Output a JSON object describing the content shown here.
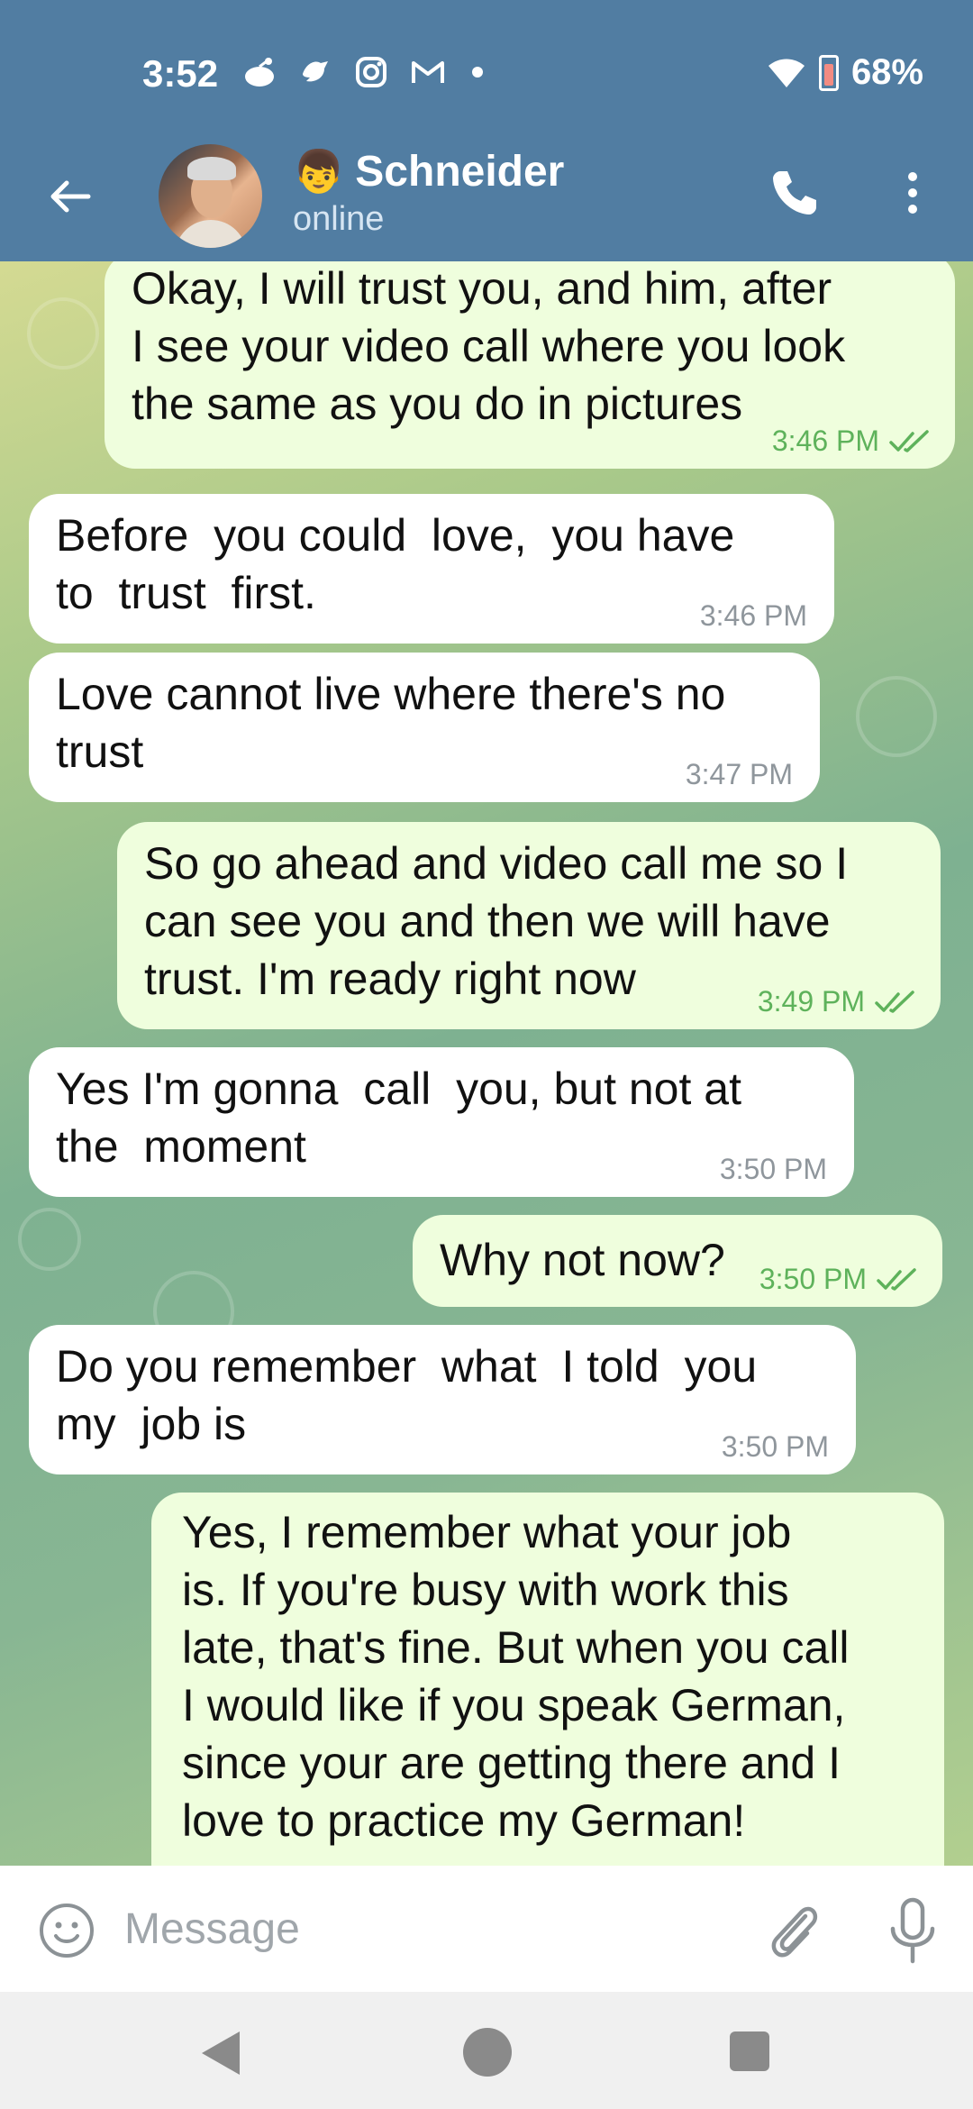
{
  "status_bar": {
    "time": "3:52",
    "battery": "68%",
    "notification_icons": [
      "reddit-icon",
      "bird-icon",
      "instagram-icon",
      "gmail-icon"
    ]
  },
  "header": {
    "contact_emoji": "👦",
    "contact_name": "Schneider",
    "presence": "online"
  },
  "messages": [
    {
      "direction": "outgoing",
      "text": "Okay, I will trust you, and him, after\nI see your video call where you look\nthe same as you do in pictures",
      "time": "3:46 PM",
      "read": true
    },
    {
      "direction": "incoming",
      "text": "Before  you could  love,  you have\nto  trust  first.",
      "time": "3:46 PM"
    },
    {
      "direction": "incoming",
      "text": "Love cannot live where there's no\ntrust",
      "time": "3:47 PM"
    },
    {
      "direction": "outgoing",
      "text": "So go ahead and video call me so I\ncan see you and then we will have\ntrust. I'm ready right now",
      "time": "3:49 PM",
      "read": true
    },
    {
      "direction": "incoming",
      "text": "Yes I'm gonna  call  you, but not at\nthe  moment",
      "time": "3:50 PM"
    },
    {
      "direction": "outgoing",
      "text": "Why not now?",
      "time": "3:50 PM",
      "read": true
    },
    {
      "direction": "incoming",
      "text": "Do you remember  what  I told  you\nmy  job is",
      "time": "3:50 PM"
    },
    {
      "direction": "outgoing",
      "text": "Yes, I remember what your job\nis. If you're busy with work this\nlate, that's fine. But when you call\nI would like if you speak German,\nsince your are getting there and I\nlove to practice my German!",
      "time": "",
      "read": false
    }
  ],
  "composer": {
    "placeholder": "Message"
  },
  "colors": {
    "header": "#517da2",
    "incoming_bubble": "#ffffff",
    "outgoing_bubble": "#effedd",
    "read_tick": "#5eb25b"
  }
}
